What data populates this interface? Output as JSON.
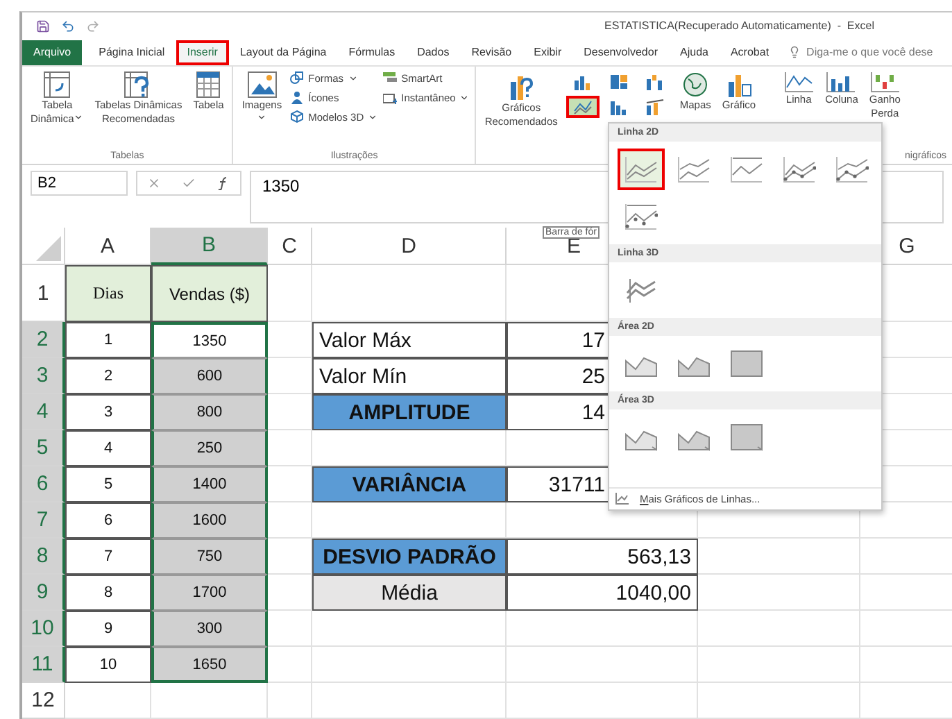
{
  "title_bar": {
    "title": "ESTATISTICA(Recuperado Automaticamente)  -  Excel"
  },
  "tabs": [
    {
      "label": "Arquivo",
      "kind": "file",
      "selected": false,
      "highlighted": false
    },
    {
      "label": "Página Inicial",
      "kind": "tab",
      "selected": false,
      "highlighted": false
    },
    {
      "label": "Inserir",
      "kind": "tab",
      "selected": true,
      "highlighted": true
    },
    {
      "label": "Layout da Página",
      "kind": "tab",
      "selected": false,
      "highlighted": false
    },
    {
      "label": "Fórmulas",
      "kind": "tab",
      "selected": false,
      "highlighted": false
    },
    {
      "label": "Dados",
      "kind": "tab",
      "selected": false,
      "highlighted": false
    },
    {
      "label": "Revisão",
      "kind": "tab",
      "selected": false,
      "highlighted": false
    },
    {
      "label": "Exibir",
      "kind": "tab",
      "selected": false,
      "highlighted": false
    },
    {
      "label": "Desenvolvedor",
      "kind": "tab",
      "selected": false,
      "highlighted": false
    },
    {
      "label": "Ajuda",
      "kind": "tab",
      "selected": false,
      "highlighted": false
    },
    {
      "label": "Acrobat",
      "kind": "tab",
      "selected": false,
      "highlighted": false
    }
  ],
  "tell_me": {
    "placeholder": "Diga-me o que você dese"
  },
  "ribbon": {
    "tables": {
      "label": "Tabelas",
      "items": [
        {
          "kind": "pivot",
          "lines": [
            "Tabela",
            "Dinâmica"
          ],
          "caret": true
        },
        {
          "kind": "recommended-pivot",
          "lines": [
            "Tabelas Dinâmicas",
            "Recomendadas"
          ],
          "caret": false
        },
        {
          "kind": "table",
          "lines": [
            "Tabela"
          ],
          "caret": false
        }
      ]
    },
    "illustrations": {
      "label": "Ilustrações",
      "images": {
        "label": "Imagens",
        "caret": true
      },
      "small": [
        {
          "kind": "shapes",
          "label": "Formas",
          "caret": true
        },
        {
          "kind": "icons",
          "label": "Ícones",
          "caret": false
        },
        {
          "kind": "models",
          "label": "Modelos 3D",
          "caret": true
        },
        {
          "kind": "smartart",
          "label": "SmartArt",
          "caret": false
        },
        {
          "kind": "screenshot",
          "label": "Instantâneo",
          "caret": true
        }
      ]
    },
    "charts": {
      "recommended": {
        "lines": [
          "Gráficos",
          "Recomendados"
        ]
      },
      "buttons": [
        {
          "kind": "column",
          "selected": false,
          "highlighted": false
        },
        {
          "kind": "hierarchy",
          "selected": false,
          "highlighted": false
        },
        {
          "kind": "waterfall",
          "selected": false,
          "highlighted": false
        },
        {
          "kind": "line",
          "selected": true,
          "highlighted": true
        },
        {
          "kind": "statistic",
          "selected": false,
          "highlighted": false
        },
        {
          "kind": "combo",
          "selected": false,
          "highlighted": false
        }
      ],
      "large": [
        {
          "kind": "maps",
          "label": "Mapas"
        },
        {
          "kind": "pivot-chart",
          "label": "Gráfico"
        }
      ]
    },
    "sparklines": {
      "label": "nigráficos",
      "items": [
        {
          "kind": "line",
          "lines": [
            "Linha"
          ]
        },
        {
          "kind": "column",
          "lines": [
            "Coluna"
          ]
        },
        {
          "kind": "winloss",
          "lines": [
            "Ganho",
            "Perda"
          ]
        }
      ]
    }
  },
  "formula_bar": {
    "name_box": "B2",
    "formula": "1350",
    "tooltip": "Barra de fór"
  },
  "sheet": {
    "columns": [
      {
        "label": "A",
        "selected": false
      },
      {
        "label": "B",
        "selected": true
      },
      {
        "label": "C",
        "selected": false
      },
      {
        "label": "D",
        "selected": false
      },
      {
        "label": "E",
        "selected": false
      },
      {
        "label": "G",
        "selected": false
      }
    ],
    "rows": [
      {
        "number": "1",
        "selected": false,
        "cells": {
          "a": {
            "text": "Dias",
            "kind": "head"
          },
          "b": {
            "text": "Vendas ($)",
            "kind": "head"
          }
        }
      },
      {
        "number": "2",
        "selected": true,
        "cells": {
          "a": {
            "text": "1",
            "kind": "number"
          },
          "b": {
            "text": "1350",
            "kind": "active"
          },
          "d": {
            "text": "Valor Máx",
            "kind": "label"
          },
          "e": {
            "text": "17",
            "kind": "clipped"
          }
        }
      },
      {
        "number": "3",
        "selected": true,
        "cells": {
          "a": {
            "text": "2",
            "kind": "number"
          },
          "b": {
            "text": "600",
            "kind": "range"
          },
          "d": {
            "text": "Valor Mín",
            "kind": "label"
          },
          "e": {
            "text": "25",
            "kind": "clipped"
          }
        }
      },
      {
        "number": "4",
        "selected": true,
        "cells": {
          "a": {
            "text": "3",
            "kind": "number"
          },
          "b": {
            "text": "800",
            "kind": "range"
          },
          "d": {
            "text": "AMPLITUDE",
            "kind": "blue"
          },
          "e": {
            "text": "14",
            "kind": "clipped"
          }
        }
      },
      {
        "number": "5",
        "selected": true,
        "cells": {
          "a": {
            "text": "4",
            "kind": "number"
          },
          "b": {
            "text": "250",
            "kind": "range"
          }
        }
      },
      {
        "number": "6",
        "selected": true,
        "cells": {
          "a": {
            "text": "5",
            "kind": "number"
          },
          "b": {
            "text": "1400",
            "kind": "range"
          },
          "d": {
            "text": "VARIÂNCIA",
            "kind": "blue"
          },
          "e": {
            "text": "31711",
            "kind": "clipped"
          }
        }
      },
      {
        "number": "7",
        "selected": true,
        "cells": {
          "a": {
            "text": "6",
            "kind": "number"
          },
          "b": {
            "text": "1600",
            "kind": "range"
          }
        }
      },
      {
        "number": "8",
        "selected": true,
        "cells": {
          "a": {
            "text": "7",
            "kind": "number"
          },
          "b": {
            "text": "750",
            "kind": "range"
          },
          "d": {
            "text": "DESVIO PADRÃO",
            "kind": "blue"
          },
          "e": {
            "text": "563,13",
            "kind": "value"
          }
        }
      },
      {
        "number": "9",
        "selected": true,
        "cells": {
          "a": {
            "text": "8",
            "kind": "number"
          },
          "b": {
            "text": "1700",
            "kind": "range"
          },
          "d": {
            "text": "Média",
            "kind": "gray"
          },
          "e": {
            "text": "1040,00",
            "kind": "value"
          }
        }
      },
      {
        "number": "10",
        "selected": true,
        "cells": {
          "a": {
            "text": "9",
            "kind": "number"
          },
          "b": {
            "text": "300",
            "kind": "range"
          }
        }
      },
      {
        "number": "11",
        "selected": true,
        "cells": {
          "a": {
            "text": "10",
            "kind": "number"
          },
          "b": {
            "text": "1650",
            "kind": "range-end"
          }
        }
      },
      {
        "number": "12",
        "selected": false,
        "cells": {}
      }
    ]
  },
  "line_menu": {
    "sections": [
      {
        "title": "Linha 2D",
        "options": [
          {
            "kind": "line",
            "selected": true,
            "highlighted": true
          },
          {
            "kind": "stacked-line",
            "selected": false,
            "highlighted": false
          },
          {
            "kind": "full-line",
            "selected": false,
            "highlighted": false
          },
          {
            "kind": "line-markers",
            "selected": false,
            "highlighted": false
          },
          {
            "kind": "stacked-markers",
            "selected": false,
            "highlighted": false
          },
          {
            "kind": "full-markers",
            "selected": false,
            "highlighted": false
          }
        ]
      },
      {
        "title": "Linha 3D",
        "options": [
          {
            "kind": "line-3d",
            "selected": false,
            "highlighted": false
          }
        ]
      },
      {
        "title": "Área 2D",
        "options": [
          {
            "kind": "area",
            "selected": false,
            "highlighted": false
          },
          {
            "kind": "stacked-area",
            "selected": false,
            "highlighted": false
          },
          {
            "kind": "full-area",
            "selected": false,
            "highlighted": false
          }
        ]
      },
      {
        "title": "Área 3D",
        "options": [
          {
            "kind": "area-3d",
            "selected": false,
            "highlighted": false
          },
          {
            "kind": "stacked-area-3d",
            "selected": false,
            "highlighted": false
          },
          {
            "kind": "full-area-3d",
            "selected": false,
            "highlighted": false
          }
        ]
      }
    ],
    "more": {
      "accelerator": "M",
      "rest": "ais Gráficos de Linhas..."
    }
  }
}
